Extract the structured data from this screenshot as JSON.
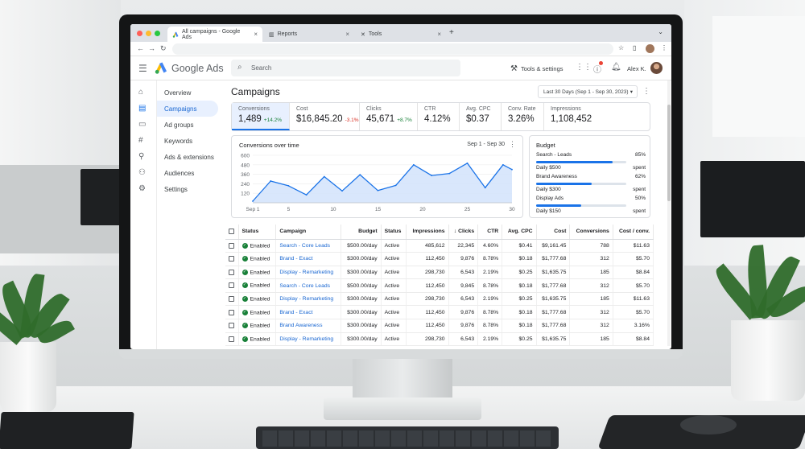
{
  "browser": {
    "tabs": [
      {
        "label": "All campaigns - Google Ads"
      },
      {
        "label": "Reports"
      },
      {
        "label": "Tools"
      }
    ],
    "new_tab": "+"
  },
  "app": {
    "brand": "Google Ads",
    "search_placeholder": "Search",
    "tools_label": "Tools & settings",
    "user_name": "Alex K."
  },
  "sidebar": {
    "items": [
      {
        "label": "Overview",
        "icon": "home-icon"
      },
      {
        "label": "Campaigns",
        "icon": "campaigns-icon",
        "selected": true
      },
      {
        "label": "Ad groups",
        "icon": "ad-groups-icon"
      },
      {
        "label": "Keywords",
        "icon": "keywords-icon"
      },
      {
        "label": "Ads & extensions",
        "icon": "ads-icon"
      },
      {
        "label": "Audiences",
        "icon": "audiences-icon"
      },
      {
        "label": "Settings",
        "icon": "settings-icon"
      }
    ]
  },
  "page": {
    "title": "Campaigns",
    "date_range": "Last 30 Days (Sep 1 - Sep 30, 2023)"
  },
  "metrics": [
    {
      "label": "Conversions",
      "value": "1,489",
      "delta": "+14.2%",
      "trend": "up"
    },
    {
      "label": "Cost",
      "value": "$16,845.20",
      "delta": "-3.1%",
      "trend": "down"
    },
    {
      "label": "Clicks",
      "value": "45,671",
      "delta": "+8.7%",
      "trend": "up"
    },
    {
      "label": "CTR",
      "value": "4.12%",
      "delta": ""
    },
    {
      "label": "Avg. CPC",
      "value": "$0.37",
      "delta": ""
    },
    {
      "label": "Conv. Rate",
      "value": "3.26%",
      "delta": ""
    },
    {
      "label": "Impressions",
      "value": "1,108,452",
      "delta": ""
    }
  ],
  "chart_data": {
    "type": "area",
    "title": "Conversions over time",
    "range_label": "Sep 1 - Sep 30",
    "x": [
      1,
      3,
      5,
      7,
      9,
      11,
      13,
      15,
      17,
      19,
      21,
      23,
      25,
      27,
      29,
      30
    ],
    "x_ticks": [
      "Sep 1",
      "5",
      "10",
      "15",
      "20",
      "25",
      "30"
    ],
    "x_tick_values": [
      1,
      5,
      10,
      15,
      20,
      25,
      30
    ],
    "y_ticks": [
      "600",
      "480",
      "360",
      "240",
      "120"
    ],
    "y_tick_values": [
      600,
      480,
      360,
      240,
      120
    ],
    "ylim": [
      0,
      600
    ],
    "values": [
      20,
      275,
      215,
      100,
      330,
      150,
      355,
      155,
      220,
      480,
      345,
      370,
      500,
      190,
      480,
      420
    ],
    "color": "#1a73e8",
    "fill": "#d2e3fc"
  },
  "budget": {
    "title": "Budget",
    "items": [
      {
        "name": "Search - Leads",
        "pct_label": "85%",
        "fraction": 0.85,
        "daily": "Daily $500",
        "status": "spent"
      },
      {
        "name": "Brand Awareness",
        "pct_label": "62%",
        "fraction": 0.62,
        "daily": "Daily $300",
        "status": "spent"
      },
      {
        "name": "Display Ads",
        "pct_label": "50%",
        "fraction": 0.5,
        "daily": "Daily $150",
        "status": "spent"
      }
    ]
  },
  "table": {
    "headers": [
      "Status",
      "Campaign",
      "Budget",
      "Status",
      "Impressions",
      "↓ Clicks",
      "CTR",
      "Avg. CPC",
      "Cost",
      "Conversions",
      "Cost / conv."
    ],
    "rows": [
      [
        "Enabled",
        "Search - Core Leads",
        "$500.00/day",
        "Active",
        "485,612",
        "22,345",
        "4.60%",
        "$0.41",
        "$9,161.45",
        "788",
        "$11.63"
      ],
      [
        "Enabled",
        "Brand - Exact",
        "$300.00/day",
        "Active",
        "112,450",
        "9,876",
        "8.78%",
        "$0.18",
        "$1,777.68",
        "312",
        "$5.70"
      ],
      [
        "Enabled",
        "Display - Remarketing",
        "$300.00/day",
        "Active",
        "298,730",
        "6,543",
        "2.19%",
        "$0.25",
        "$1,635.75",
        "185",
        "$8.84"
      ],
      [
        "Enabled",
        "Search - Core Leads",
        "$500.00/day",
        "Active",
        "112,450",
        "9,845",
        "8.78%",
        "$0.18",
        "$1,777.68",
        "312",
        "$5.70"
      ],
      [
        "Enabled",
        "Display - Remarketing",
        "$300.00/day",
        "Active",
        "298,730",
        "6,543",
        "2.19%",
        "$0.25",
        "$1,635.75",
        "185",
        "$11.63"
      ],
      [
        "Enabled",
        "Brand - Exact",
        "$300.00/day",
        "Active",
        "112,450",
        "9,876",
        "8.78%",
        "$0.18",
        "$1,777.68",
        "312",
        "$5.70"
      ],
      [
        "Enabled",
        "Brand Awareness",
        "$300.00/day",
        "Active",
        "112,450",
        "9,876",
        "8.78%",
        "$0.18",
        "$1,777.68",
        "312",
        "3.16%"
      ],
      [
        "Enabled",
        "Display - Remarketing",
        "$300.00/day",
        "Active",
        "298,730",
        "6,543",
        "2.19%",
        "$0.25",
        "$1,635.75",
        "185",
        "$8.84"
      ]
    ]
  }
}
